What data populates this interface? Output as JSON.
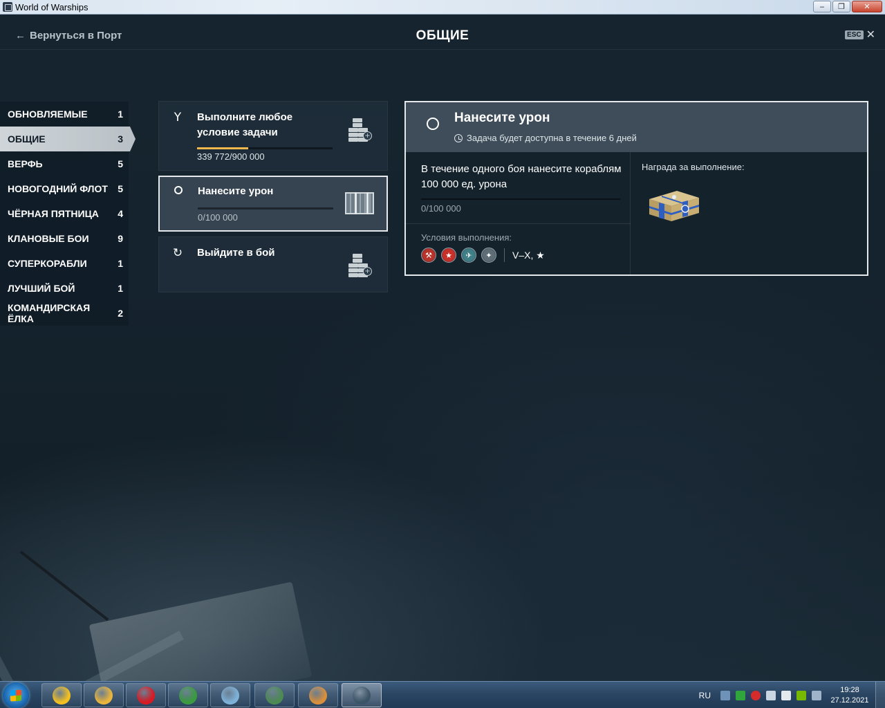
{
  "window": {
    "title": "World of Warships",
    "minimize": "‒",
    "maximize": "❐",
    "close": "✕"
  },
  "header": {
    "back_label": "Вернуться в Порт",
    "back_icon": "←",
    "page_title": "ОБЩИЕ",
    "esc_key": "ESC",
    "close_icon": "✕"
  },
  "sidebar": {
    "items": [
      {
        "label": "ОБНОВЛЯЕМЫЕ",
        "count": "1"
      },
      {
        "label": "ОБЩИЕ",
        "count": "3"
      },
      {
        "label": "ВЕРФЬ",
        "count": "5"
      },
      {
        "label": "НОВОГОДНИЙ ФЛОТ",
        "count": "5"
      },
      {
        "label": "ЧЁРНАЯ ПЯТНИЦА",
        "count": "4"
      },
      {
        "label": "КЛАНОВЫЕ БОИ",
        "count": "9"
      },
      {
        "label": "СУПЕРКОРАБЛИ",
        "count": "1"
      },
      {
        "label": "ЛУЧШИЙ БОЙ",
        "count": "1"
      },
      {
        "label": "КОМАНДИРСКАЯ ЁЛКА",
        "count": "2"
      }
    ],
    "active_index": 1
  },
  "tasks": [
    {
      "title": "Выполните любое условие задачи",
      "icon": "branch-icon",
      "glyph": "Y",
      "progress": 0.3775,
      "value": "339 772",
      "target": "/900 000",
      "reward_icon": "credits-icon"
    },
    {
      "title": "Нанесите урон",
      "icon": "ring-icon",
      "progress": 0,
      "value": "0",
      "target": "/100 000",
      "reward_icon": "crate-icon"
    },
    {
      "title": "Выйдите в бой",
      "icon": "refresh-icon",
      "glyph": "↻",
      "reward_icon": "credits-icon"
    }
  ],
  "detail": {
    "title": "Нанесите урон",
    "availability": "Задача будет доступна в течение 6 дней",
    "description": "В течение одного боя нанесите кораблям 100 000 ед. урона",
    "progress": 0,
    "value": "0",
    "target": "/100 000",
    "conditions_label": "Условия выполнения:",
    "nations": [
      {
        "name": "nation-ussr-icon",
        "glyph": "⚒",
        "color": "#b8332a"
      },
      {
        "name": "nation-china-icon",
        "glyph": "★",
        "color": "#c8302a"
      },
      {
        "name": "nation-pan-asia-icon",
        "glyph": "✈",
        "color": "#3f7f86"
      },
      {
        "name": "nation-europe-icon",
        "glyph": "✦",
        "color": "#5f6e76"
      }
    ],
    "tiers": "V–X, ★",
    "reward_label": "Награда за выполнение:",
    "reward_icon": "gift-crate-icon"
  },
  "taskbar": {
    "apps": [
      {
        "name": "archicad-icon",
        "color": "#f3c020",
        "active": false
      },
      {
        "name": "explorer-icon",
        "color": "#e9b53c",
        "active": false
      },
      {
        "name": "opera-icon",
        "color": "#d81a22",
        "active": false
      },
      {
        "name": "chrome-icon",
        "color": "#3a9a3f",
        "active": false
      },
      {
        "name": "notepad-icon",
        "color": "#7fb2d8",
        "active": false
      },
      {
        "name": "monitor-app-icon",
        "color": "#4c8a52",
        "active": false
      },
      {
        "name": "paint-icon",
        "color": "#d88f3c",
        "active": false
      },
      {
        "name": "warships-icon",
        "color": "#3c5566",
        "active": true
      }
    ],
    "lang": "RU",
    "time": "19:28",
    "date": "27.12.2021"
  },
  "colors": {
    "accent_progress": "#f0b84a",
    "active_tab_bg": "#cfd5d9",
    "panel_border": "#e6eaec"
  }
}
